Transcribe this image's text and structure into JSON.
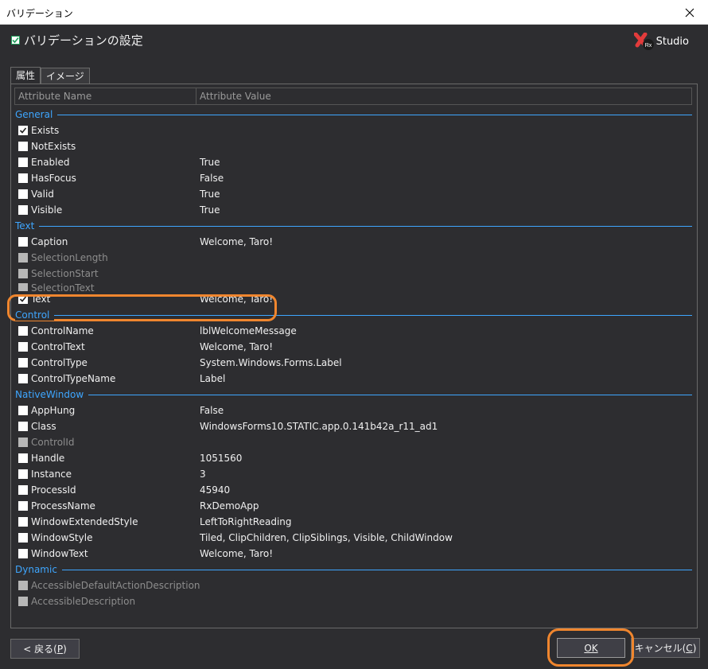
{
  "window": {
    "title": "バリデーション"
  },
  "header": {
    "heading": "バリデーションの設定",
    "logo_text": "Studio",
    "logo_mark": "Rx"
  },
  "tabs": [
    {
      "label": "属性",
      "active": true
    },
    {
      "label": "イメージ",
      "active": false
    }
  ],
  "columns": {
    "name": "Attribute Name",
    "value": "Attribute Value"
  },
  "groups": [
    {
      "label": "General",
      "rows": [
        {
          "name": "Exists",
          "value": "",
          "checked": true,
          "enabled": true
        },
        {
          "name": "NotExists",
          "value": "",
          "checked": false,
          "enabled": true
        },
        {
          "name": "Enabled",
          "value": "True",
          "checked": false,
          "enabled": true
        },
        {
          "name": "HasFocus",
          "value": "False",
          "checked": false,
          "enabled": true
        },
        {
          "name": "Valid",
          "value": "True",
          "checked": false,
          "enabled": true
        },
        {
          "name": "Visible",
          "value": "True",
          "checked": false,
          "enabled": true
        }
      ]
    },
    {
      "label": "Text",
      "rows": [
        {
          "name": "Caption",
          "value": "Welcome, Taro!",
          "checked": false,
          "enabled": true
        },
        {
          "name": "SelectionLength",
          "value": "",
          "checked": false,
          "enabled": false
        },
        {
          "name": "SelectionStart",
          "value": "",
          "checked": false,
          "enabled": false
        },
        {
          "name": "SelectionText",
          "value": "",
          "checked": false,
          "enabled": false
        },
        {
          "name": "Text",
          "value": "Welcome, Taro!",
          "checked": true,
          "enabled": true
        }
      ]
    },
    {
      "label": "Control",
      "rows": [
        {
          "name": "ControlName",
          "value": "lblWelcomeMessage",
          "checked": false,
          "enabled": true
        },
        {
          "name": "ControlText",
          "value": "Welcome, Taro!",
          "checked": false,
          "enabled": true
        },
        {
          "name": "ControlType",
          "value": "System.Windows.Forms.Label",
          "checked": false,
          "enabled": true
        },
        {
          "name": "ControlTypeName",
          "value": "Label",
          "checked": false,
          "enabled": true
        }
      ]
    },
    {
      "label": "NativeWindow",
      "rows": [
        {
          "name": "AppHung",
          "value": "False",
          "checked": false,
          "enabled": true
        },
        {
          "name": "Class",
          "value": "WindowsForms10.STATIC.app.0.141b42a_r11_ad1",
          "checked": false,
          "enabled": true
        },
        {
          "name": "ControlId",
          "value": "",
          "checked": false,
          "enabled": false
        },
        {
          "name": "Handle",
          "value": "1051560",
          "checked": false,
          "enabled": true
        },
        {
          "name": "Instance",
          "value": "3",
          "checked": false,
          "enabled": true
        },
        {
          "name": "ProcessId",
          "value": "45940",
          "checked": false,
          "enabled": true
        },
        {
          "name": "ProcessName",
          "value": "RxDemoApp",
          "checked": false,
          "enabled": true
        },
        {
          "name": "WindowExtendedStyle",
          "value": "LeftToRightReading",
          "checked": false,
          "enabled": true
        },
        {
          "name": "WindowStyle",
          "value": "Tiled, ClipChildren, ClipSiblings, Visible, ChildWindow",
          "checked": false,
          "enabled": true
        },
        {
          "name": "WindowText",
          "value": "Welcome, Taro!",
          "checked": false,
          "enabled": true
        }
      ]
    },
    {
      "label": "Dynamic",
      "rows": [
        {
          "name": "AccessibleDefaultActionDescription",
          "value": "",
          "checked": false,
          "enabled": false
        },
        {
          "name": "AccessibleDescription",
          "value": "",
          "checked": false,
          "enabled": false
        }
      ]
    }
  ],
  "buttons": {
    "back_text": "< 戻る(",
    "back_key": "P",
    "back_end": ")",
    "ok_label": "OK",
    "cancel_text": "キャンセル(",
    "cancel_key": "C",
    "cancel_end": ")"
  },
  "colors": {
    "accent": "#3ea6ff",
    "highlight": "#f0862e",
    "background": "#2d2d30"
  }
}
